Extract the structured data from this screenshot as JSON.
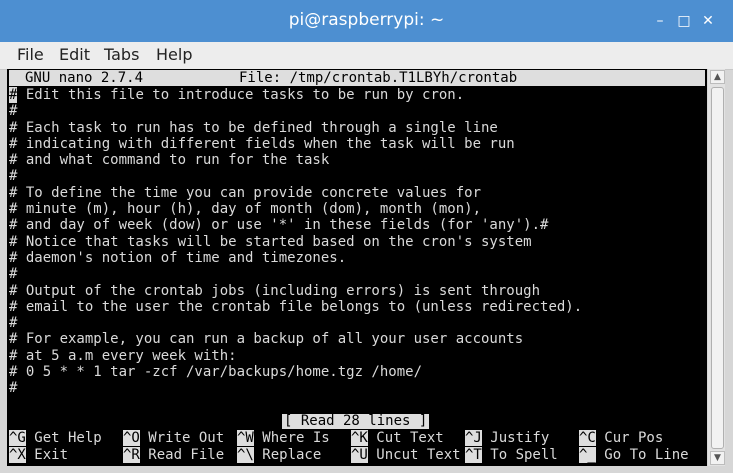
{
  "window": {
    "title": "pi@raspberrypi: ~",
    "minimize_glyph": "–",
    "maximize_glyph": "□",
    "close_glyph": "✕"
  },
  "menubar": [
    "File",
    "Edit",
    "Tabs",
    "Help"
  ],
  "nano": {
    "version": "GNU nano 2.7.4",
    "file": "File: /tmp/crontab.T1LBYh/crontab",
    "lines": [
      "# Edit this file to introduce tasks to be run by cron.",
      "#",
      "# Each task to run has to be defined through a single line",
      "# indicating with different fields when the task will be run",
      "# and what command to run for the task",
      "#",
      "# To define the time you can provide concrete values for",
      "# minute (m), hour (h), day of month (dom), month (mon),",
      "# and day of week (dow) or use '*' in these fields (for 'any').#",
      "# Notice that tasks will be started based on the cron's system",
      "# daemon's notion of time and timezones.",
      "#",
      "# Output of the crontab jobs (including errors) is sent through",
      "# email to the user the crontab file belongs to (unless redirected).",
      "#",
      "# For example, you can run a backup of all your user accounts",
      "# at 5 a.m every week with:",
      "# 0 5 * * 1 tar -zcf /var/backups/home.tgz /home/",
      "#"
    ],
    "status": "[ Read 28 lines ]",
    "shortcuts_row1": [
      {
        "key": "^G",
        "label": " Get Help"
      },
      {
        "key": "^O",
        "label": " Write Out"
      },
      {
        "key": "^W",
        "label": " Where Is"
      },
      {
        "key": "^K",
        "label": " Cut Text"
      },
      {
        "key": "^J",
        "label": " Justify"
      },
      {
        "key": "^C",
        "label": " Cur Pos"
      }
    ],
    "shortcuts_row2": [
      {
        "key": "^X",
        "label": " Exit"
      },
      {
        "key": "^R",
        "label": " Read File"
      },
      {
        "key": "^\\",
        "label": " Replace"
      },
      {
        "key": "^U",
        "label": " Uncut Text"
      },
      {
        "key": "^T",
        "label": " To Spell"
      },
      {
        "key": "^_",
        "label": " Go To Line"
      }
    ]
  },
  "scrollbar": {
    "up_glyph": "▲",
    "down_glyph": "▼"
  },
  "colors": {
    "titlebar": "#4d8fd1",
    "terminal_bg": "#000000",
    "terminal_fg": "#dadada"
  }
}
